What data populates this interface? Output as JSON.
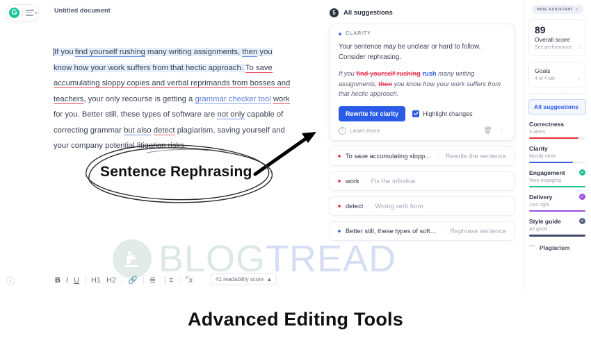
{
  "app": {
    "logo": {
      "mark": "G",
      "menu_icon": "hamburger-menu-icon"
    },
    "document_title": "Untitled document"
  },
  "document": {
    "paragraph_runs": [
      {
        "text": "If you ",
        "style": "highlight"
      },
      {
        "text": "find yourself rushing",
        "style": "highlight underline-blue"
      },
      {
        "text": " many writing assignments, ",
        "style": "highlight"
      },
      {
        "text": "then",
        "style": "highlight underline-blue"
      },
      {
        "text": " you know how your work suffers from that hectic approach. ",
        "style": "highlight"
      },
      {
        "text": "To save accumulating sloppy copies and verbal reprimands from bosses and teachers",
        "style": "underline-red"
      },
      {
        "text": ", your only recourse is getting a ",
        "style": "plain"
      },
      {
        "text": "grammar checker tool",
        "style": "link-blue"
      },
      {
        "text": " ",
        "style": "plain"
      },
      {
        "text": "work",
        "style": "underline-red"
      },
      {
        "text": " for you. Better still, these types of software are ",
        "style": "plain"
      },
      {
        "text": "not only",
        "style": "underline-blue"
      },
      {
        "text": " capable of correcting grammar ",
        "style": "plain"
      },
      {
        "text": "but also",
        "style": "underline-blue"
      },
      {
        "text": " ",
        "style": "plain"
      },
      {
        "text": "detect",
        "style": "underline-red"
      },
      {
        "text": " plagiarism, saving yourself and your company potential litigation risks.",
        "style": "plain"
      }
    ]
  },
  "toolbar": {
    "help_icon": "help-circle-icon",
    "bold": "B",
    "italic": "I",
    "underline": "U",
    "heading1": "H1",
    "heading2": "H2",
    "link_icon": "link-icon",
    "ordered_list_icon": "ordered-list-icon",
    "bullet_list_icon": "bullet-list-icon",
    "clear_format_icon": "clear-formatting-icon",
    "readability": "41 readability score",
    "readability_caret": "▲"
  },
  "suggestions": {
    "header_count": "5",
    "header_label": "All suggestions",
    "card": {
      "category": "CLARITY",
      "description": "Your sentence may be unclear or hard to follow. Consider rephrasing.",
      "preview": {
        "part1": "If you ",
        "deleted1": "find yourself rushing",
        "inserted1": "rush",
        "part2": " many writing assignments, ",
        "deleted2": "then",
        "part3": " you know how your work suffers from that hectic approach."
      },
      "primary_button": "Rewrite for clarity",
      "checkbox_label": "Highlight changes",
      "checkbox_checked": true,
      "learn_more": "Learn more",
      "delete_icon": "trash-icon",
      "more_icon": "more-vertical-icon"
    },
    "items": [
      {
        "text": "To save accumulating sloppy co...",
        "hint": "Rewrite the sentence",
        "dot": "red"
      },
      {
        "text": "work",
        "hint": "Fix the infinitive",
        "dot": "red"
      },
      {
        "text": "detect",
        "hint": "Wrong verb form",
        "dot": "red"
      },
      {
        "text": "Better still, these types of softwar...",
        "hint": "Rephrase sentence",
        "dot": "blue"
      }
    ],
    "separator": "·"
  },
  "assistant": {
    "hide_button": "HIDE ASSISTANT",
    "hide_chevron": "»",
    "overall": {
      "score": "89",
      "label": "Overall score",
      "sub": "See performance",
      "chevron": "›"
    },
    "goals": {
      "label": "Goals",
      "sub": "4 of 4 set",
      "chevron": "›"
    },
    "all_suggestions_button": "All suggestions",
    "metrics": [
      {
        "name": "Correctness",
        "sub": "3 alerts",
        "bar_pct": 88,
        "bar_color": "#ec2b2b",
        "check": false,
        "check_color": ""
      },
      {
        "name": "Clarity",
        "sub": "Mostly clear",
        "bar_pct": 78,
        "bar_color": "#3b5bdb",
        "check": false,
        "check_color": ""
      },
      {
        "name": "Engagement",
        "sub": "Very engaging",
        "bar_pct": 100,
        "bar_color": "#18c08f",
        "check": true,
        "check_color": "#18c08f"
      },
      {
        "name": "Delivery",
        "sub": "Just right",
        "bar_pct": 100,
        "bar_color": "#9b4fe0",
        "check": true,
        "check_color": "#9b4fe0"
      },
      {
        "name": "Style guide",
        "sub": "All good",
        "bar_pct": 100,
        "bar_color": "#3f4a66",
        "check": true,
        "check_color": "#5a6480"
      }
    ],
    "plagiarism": {
      "icon": "quote-icon",
      "label": "Plagiarism"
    }
  },
  "annotation": {
    "label": "Sentence Rephrasing",
    "circle": "hand-drawn-ellipse",
    "arrow": "hand-drawn-arrow"
  },
  "watermark": {
    "text_a": "BLOG",
    "text_b": "TREAD",
    "icon": "treadmill-icon"
  },
  "caption": "Advanced Editing Tools",
  "colors": {
    "brand_green": "#15c39a",
    "accent_blue": "#2b5ce8",
    "alert_red": "#e8425f",
    "highlight": "#e3edfb"
  }
}
